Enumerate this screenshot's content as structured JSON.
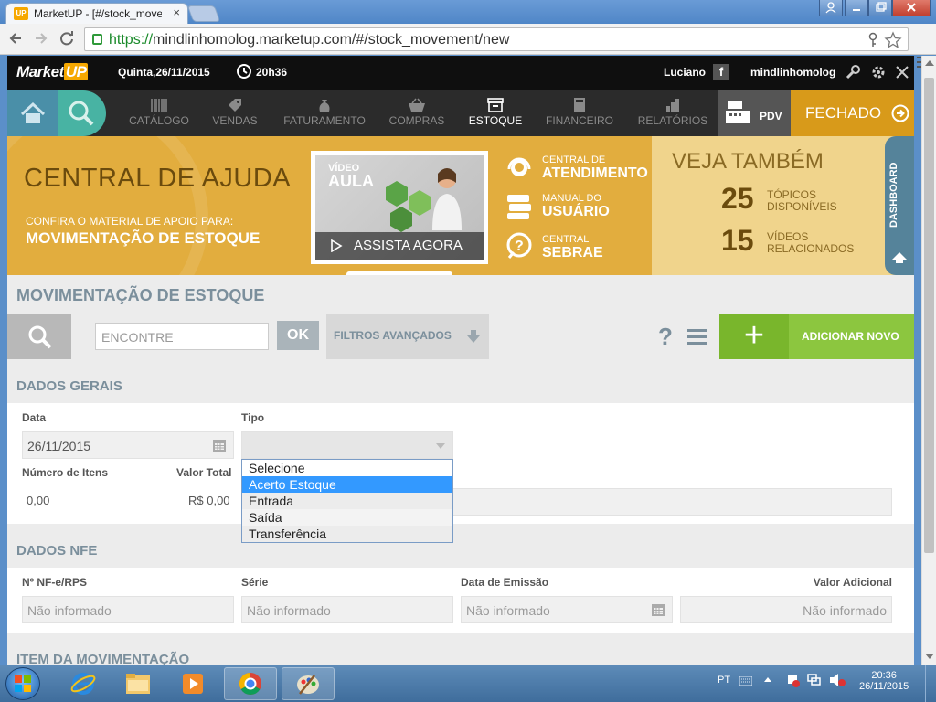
{
  "browser": {
    "tab_title": "MarketUP - [#/stock_move",
    "tab_favicon": "UP",
    "close_tab": "×",
    "url_scheme": "https://",
    "url_rest": "mindlinhomolog.marketup.com/#/stock_movement/new"
  },
  "app": {
    "brand": "Market",
    "brand_up": "UP",
    "date": "Quinta,26/11/2015",
    "time": "20h36",
    "user": "Luciano",
    "facebook": "f",
    "account": "mindlinhomolog"
  },
  "nav": {
    "items": [
      {
        "label": "CATÁLOGO",
        "icon": "barcode-icon"
      },
      {
        "label": "VENDAS",
        "icon": "tag-icon"
      },
      {
        "label": "FATURAMENTO",
        "icon": "money-bag-icon"
      },
      {
        "label": "COMPRAS",
        "icon": "basket-icon"
      },
      {
        "label": "ESTOQUE",
        "icon": "box-icon",
        "active": true
      },
      {
        "label": "FINANCEIRO",
        "icon": "calculator-icon"
      },
      {
        "label": "RELATÓRIOS",
        "icon": "bar-chart-icon"
      }
    ],
    "pdv": "PDV",
    "status": "FECHADO"
  },
  "help": {
    "title": "CENTRAL DE AJUDA",
    "subtitle": "CONFIRA O MATERIAL DE APOIO PARA:",
    "topic": "MOVIMENTAÇÃO DE ESTOQUE",
    "video_label_small": "VÍDEO",
    "video_label_big": "AULA",
    "video_cta": "ASSISTA AGORA",
    "support": [
      {
        "line1": "CENTRAL DE",
        "line2": "ATENDIMENTO"
      },
      {
        "line1": "MANUAL DO",
        "line2": "USUÁRIO"
      },
      {
        "line1": "CENTRAL",
        "line2": "SEBRAE"
      }
    ],
    "veja_title": "VEJA TAMBÉM",
    "topics_count": "25",
    "topics_label1": "TÓPICOS",
    "topics_label2": "DISPONÍVEIS",
    "videos_count": "15",
    "videos_label1": "VÍDEOS",
    "videos_label2": "RELACIONADOS",
    "dashboard_tab": "DASHBOARD"
  },
  "page": {
    "title": "MOVIMENTAÇÃO DE ESTOQUE",
    "search_placeholder": "ENCONTRE",
    "ok": "OK",
    "filters": "FILTROS AVANÇADOS",
    "help": "?",
    "add_new": "ADICIONAR NOVO"
  },
  "general": {
    "section": "DADOS GERAIS",
    "date_label": "Data",
    "date_value": "26/11/2015",
    "type_label": "Tipo",
    "items_label": "Número de Itens",
    "items_value": "0,00",
    "total_label": "Valor Total",
    "total_value": "R$ 0,00",
    "type_options": [
      "Selecione",
      "Acerto Estoque",
      "Entrada",
      "Saída",
      "Transferência"
    ],
    "type_highlighted": "Acerto Estoque"
  },
  "nfe": {
    "section": "DADOS NFE",
    "fields": [
      {
        "label": "Nº NF-e/RPS",
        "placeholder": "Não informado"
      },
      {
        "label": "Série",
        "placeholder": "Não informado"
      },
      {
        "label": "Data de Emissão",
        "placeholder": "Não informado"
      },
      {
        "label": "Valor Adicional",
        "placeholder": "Não informado"
      }
    ]
  },
  "items_section": "ITEM DA MOVIMENTAÇÃO",
  "taskbar": {
    "language": "PT",
    "clock_time": "20:36",
    "clock_date": "26/11/2015"
  },
  "colors": {
    "brand_orange": "#f6a800",
    "help_banner": "#e2ad3e",
    "add_green": "#8cc63f",
    "selection_blue": "#3399ff"
  }
}
